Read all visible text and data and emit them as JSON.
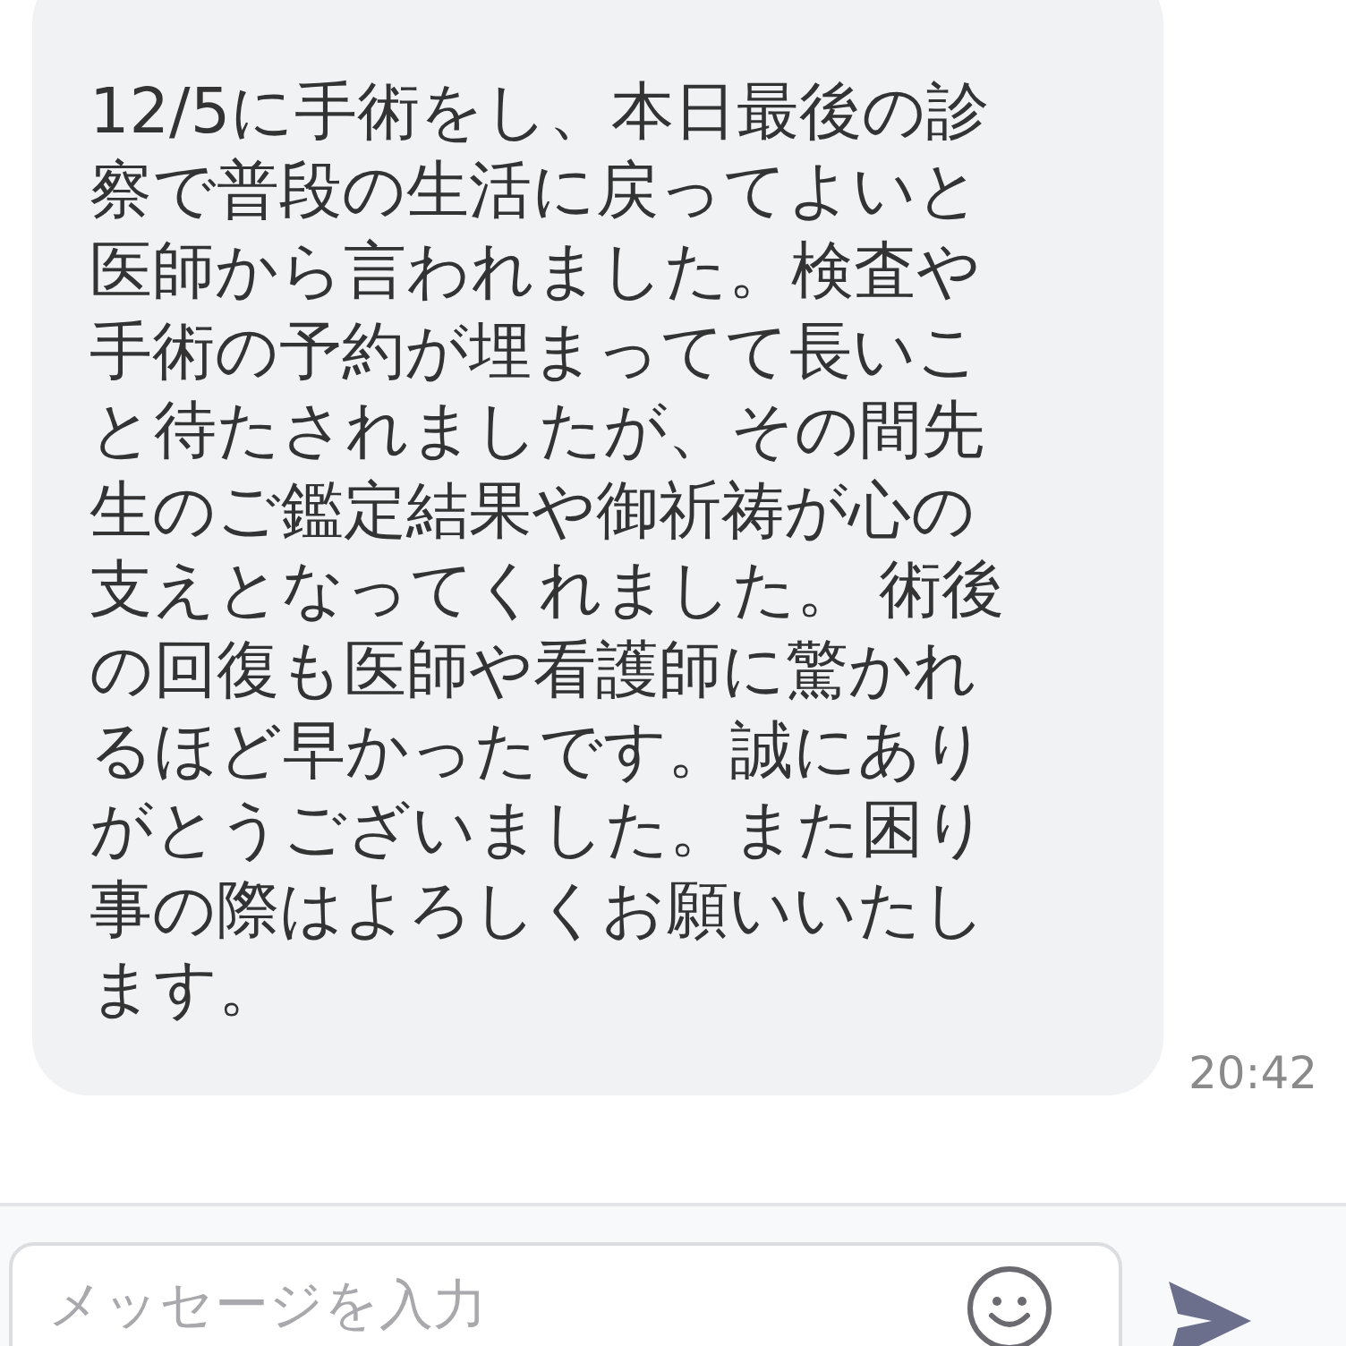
{
  "message": {
    "lines": [
      "12/5に手術をし、本日最後の診",
      "察で普段の生活に戻ってよいと",
      "医師から言われました。検査や",
      "手術の予約が埋まってて長いこ",
      "と待たされましたが、その間先",
      "生のご鑑定結果や御祈祷が心の",
      "支えとなってくれました。 術後",
      "の回復も医師や看護師に驚かれ",
      "るほど早かったです。誠にあり",
      "がとうございました。また困り",
      "事の際はよろしくお願いいたし",
      "ます。"
    ],
    "time": "20:42"
  },
  "composer": {
    "placeholder": "メッセージを入力"
  }
}
